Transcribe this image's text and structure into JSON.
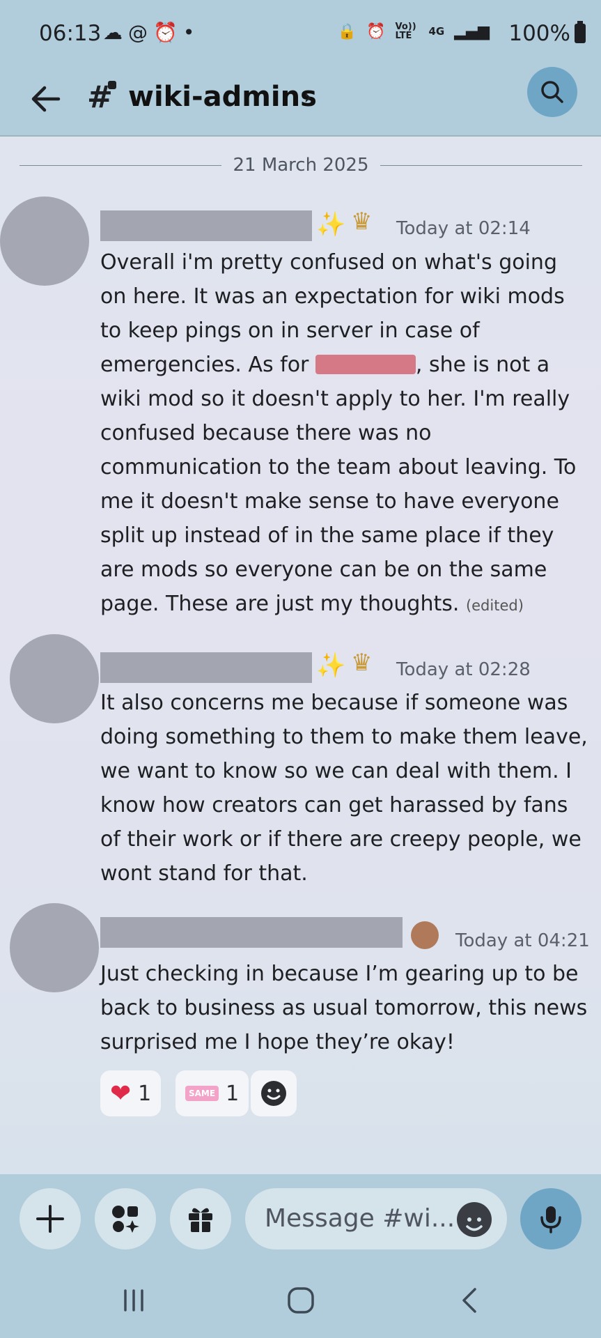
{
  "status_bar": {
    "time": "06:13",
    "battery": "100%",
    "network": "4G",
    "volte": "Vo)) LTE"
  },
  "header": {
    "channel_name": "wiki-admins",
    "chevron": "›"
  },
  "date_divider": "21 March 2025",
  "messages": [
    {
      "timestamp": "Today at 02:14",
      "text_before": "Overall i'm pretty confused on what's going on here. It was an expectation for wiki mods to keep pings on in server in case of emergencies. As for ",
      "text_after": ", she is not a wiki mod so it doesn't apply to her. I'm really confused because there was no communication to the team about leaving. To me it doesn't make sense to have everyone split up instead of in the same place if they are mods so everyone can be on the same page. These are just my thoughts. ",
      "edited": "(edited)"
    },
    {
      "timestamp": "Today at 02:28",
      "text": "It also concerns me because if someone was doing something to them to make them leave, we want to know so we can deal with them. I know how creators can get harassed by fans of their work or if there are creepy people, we wont stand for that."
    },
    {
      "timestamp": "Today at 04:21",
      "text": "Just checking in because I’m gearing up to be back to business as usual tomorrow, this news surprised me I hope they’re okay!"
    }
  ],
  "reactions": [
    {
      "emoji": "❤",
      "count": "1"
    },
    {
      "emoji": "SAME",
      "count": "1"
    }
  ],
  "composer": {
    "placeholder": "Message #wi..."
  },
  "icons": {
    "back": "arrow-left-icon",
    "search": "search-icon",
    "add": "plus-icon",
    "apps": "apps-icon",
    "gift": "gift-icon",
    "emoji": "emoji-icon",
    "mic": "microphone-icon"
  }
}
